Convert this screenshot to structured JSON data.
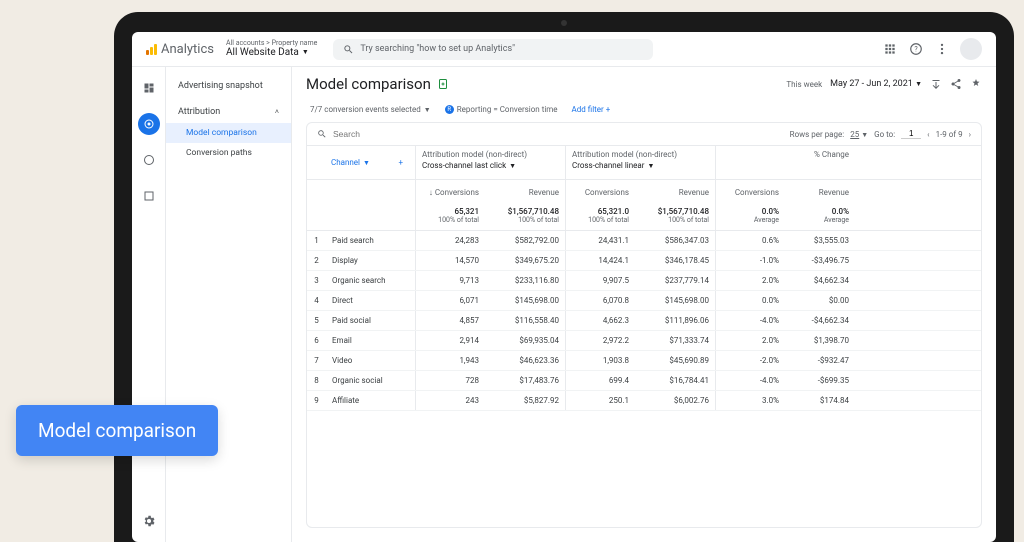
{
  "brand": "Analytics",
  "account": {
    "breadcrumb": "All accounts > Property name",
    "selected": "All Website Data"
  },
  "search": {
    "placeholder": "Try searching \"how to set up Analytics\""
  },
  "sidebar": {
    "snapshot": "Advertising snapshot",
    "section": "Attribution",
    "items": [
      "Model comparison",
      "Conversion paths"
    ]
  },
  "page": {
    "title": "Model comparison",
    "date_label": "This week",
    "date_range": "May 27 - Jun 2, 2021"
  },
  "filters": {
    "events": "7/7 conversion events selected",
    "reporting": "Reporting = Conversion time",
    "add": "Add filter +"
  },
  "table": {
    "search_placeholder": "Search",
    "rows_label": "Rows per page:",
    "rows_value": "25",
    "goto_label": "Go to:",
    "goto_value": "1",
    "range": "1-9 of 9",
    "column_header": "Channel",
    "group_a": {
      "title": "Attribution model (non-direct)",
      "model": "Cross-channel last click"
    },
    "group_b": {
      "title": "Attribution model (non-direct)",
      "model": "Cross-channel linear"
    },
    "group_c": {
      "title": "% Change"
    },
    "sub": {
      "conv": "Conversions",
      "rev": "Revenue",
      "down": "↓ Conversions"
    },
    "totals": {
      "a_conv": "65,321",
      "a_conv_sub": "100% of total",
      "a_rev": "$1,567,710.48",
      "a_rev_sub": "100% of total",
      "b_conv": "65,321.0",
      "b_conv_sub": "100% of total",
      "b_rev": "$1,567,710.48",
      "b_rev_sub": "100% of total",
      "c_conv": "0.0%",
      "c_conv_sub": "Average",
      "c_rev": "0.0%",
      "c_rev_sub": "Average"
    },
    "rows": [
      {
        "i": "1",
        "ch": "Paid search",
        "ac": "24,283",
        "ar": "$582,792.00",
        "bc": "24,431.1",
        "br": "$586,347.03",
        "cc": "0.6%",
        "cr": "$3,555.03"
      },
      {
        "i": "2",
        "ch": "Display",
        "ac": "14,570",
        "ar": "$349,675.20",
        "bc": "14,424.1",
        "br": "$346,178.45",
        "cc": "-1.0%",
        "cr": "-$3,496.75"
      },
      {
        "i": "3",
        "ch": "Organic search",
        "ac": "9,713",
        "ar": "$233,116.80",
        "bc": "9,907.5",
        "br": "$237,779.14",
        "cc": "2.0%",
        "cr": "$4,662.34"
      },
      {
        "i": "4",
        "ch": "Direct",
        "ac": "6,071",
        "ar": "$145,698.00",
        "bc": "6,070.8",
        "br": "$145,698.00",
        "cc": "0.0%",
        "cr": "$0.00"
      },
      {
        "i": "5",
        "ch": "Paid social",
        "ac": "4,857",
        "ar": "$116,558.40",
        "bc": "4,662.3",
        "br": "$111,896.06",
        "cc": "-4.0%",
        "cr": "-$4,662.34"
      },
      {
        "i": "6",
        "ch": "Email",
        "ac": "2,914",
        "ar": "$69,935.04",
        "bc": "2,972.2",
        "br": "$71,333.74",
        "cc": "2.0%",
        "cr": "$1,398.70"
      },
      {
        "i": "7",
        "ch": "Video",
        "ac": "1,943",
        "ar": "$46,623.36",
        "bc": "1,903.8",
        "br": "$45,690.89",
        "cc": "-2.0%",
        "cr": "-$932.47"
      },
      {
        "i": "8",
        "ch": "Organic social",
        "ac": "728",
        "ar": "$17,483.76",
        "bc": "699.4",
        "br": "$16,784.41",
        "cc": "-4.0%",
        "cr": "-$699.35"
      },
      {
        "i": "9",
        "ch": "Affiliate",
        "ac": "243",
        "ar": "$5,827.92",
        "bc": "250.1",
        "br": "$6,002.76",
        "cc": "3.0%",
        "cr": "$174.84"
      }
    ]
  },
  "callout": "Model comparison"
}
